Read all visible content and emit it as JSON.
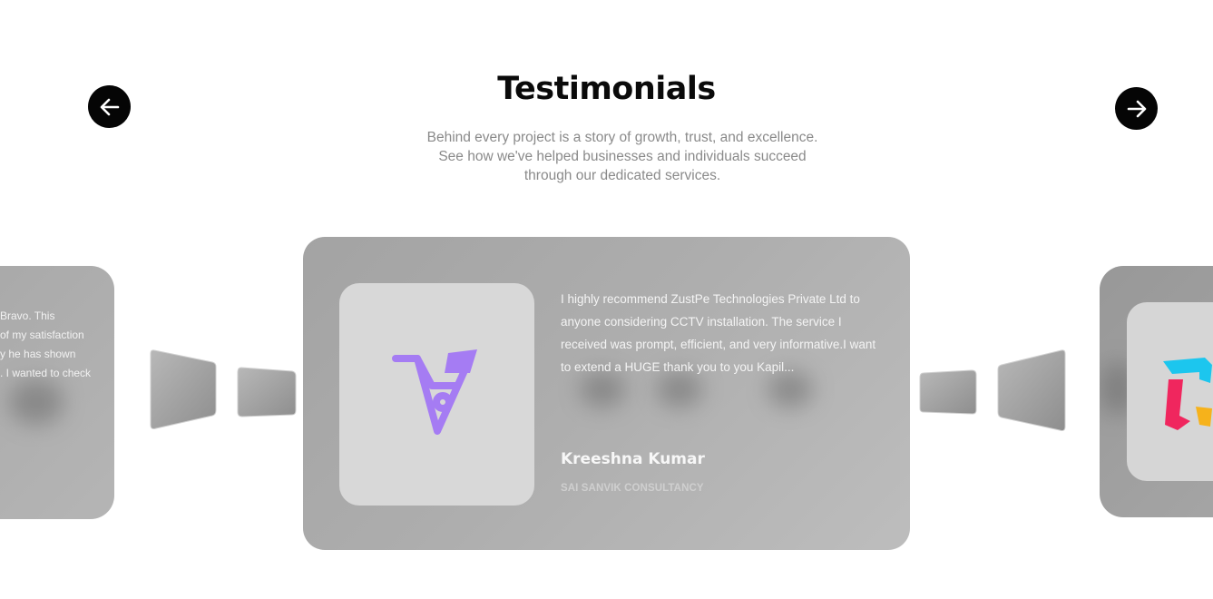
{
  "header": {
    "title": "Testimonials",
    "subtitle_lines": [
      "Behind every project is a story of growth, trust, and excellence.",
      "See how we've helped businesses and individuals succeed",
      "through our dedicated services."
    ]
  },
  "navigation": {
    "prev_icon": "arrow-left-icon",
    "next_icon": "arrow-right-icon"
  },
  "testimonials": {
    "active": {
      "quote": "I highly recommend ZustPe Technologies Private Ltd to anyone considering CCTV installation. The service I received was prompt, efficient, and very informative.I want to extend a HUGE thank you to you Kapil...",
      "name": "Kreeshna Kumar",
      "company": "SAI SANVIK CONSULTANCY",
      "logo_icon": "company-logo-icon"
    },
    "previous": {
      "quote_lines": [
        "Bravo. This",
        "of my satisfaction",
        "y he has shown",
        ". I wanted to check"
      ]
    },
    "next": {
      "logo_icon": "company-logo-icon"
    }
  },
  "colors": {
    "accent_purple": "#a57cf3",
    "nav_button": "#050505"
  }
}
